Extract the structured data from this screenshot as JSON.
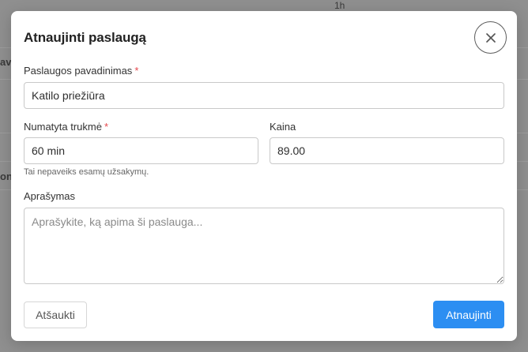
{
  "background": {
    "fragment_top": "1h",
    "fragment_left_1": "avi",
    "fragment_left_2": "on"
  },
  "modal": {
    "title": "Atnaujinti paslaugą",
    "close_icon": "close-icon"
  },
  "form": {
    "name": {
      "label": "Paslaugos pavadinimas",
      "required_mark": "*",
      "value": "Katilo priežiūra"
    },
    "duration": {
      "label": "Numatyta trukmė",
      "required_mark": "*",
      "value": "60 min",
      "hint": "Tai nepaveiks esamų užsakymų."
    },
    "price": {
      "label": "Kaina",
      "value": "89.00"
    },
    "description": {
      "label": "Aprašymas",
      "placeholder": "Aprašykite, ką apima ši paslauga..."
    }
  },
  "actions": {
    "cancel_label": "Atšaukti",
    "submit_label": "Atnaujinti"
  },
  "colors": {
    "primary": "#2c8ef2",
    "required": "#e5484d",
    "overlay": "#8f8f8f"
  }
}
